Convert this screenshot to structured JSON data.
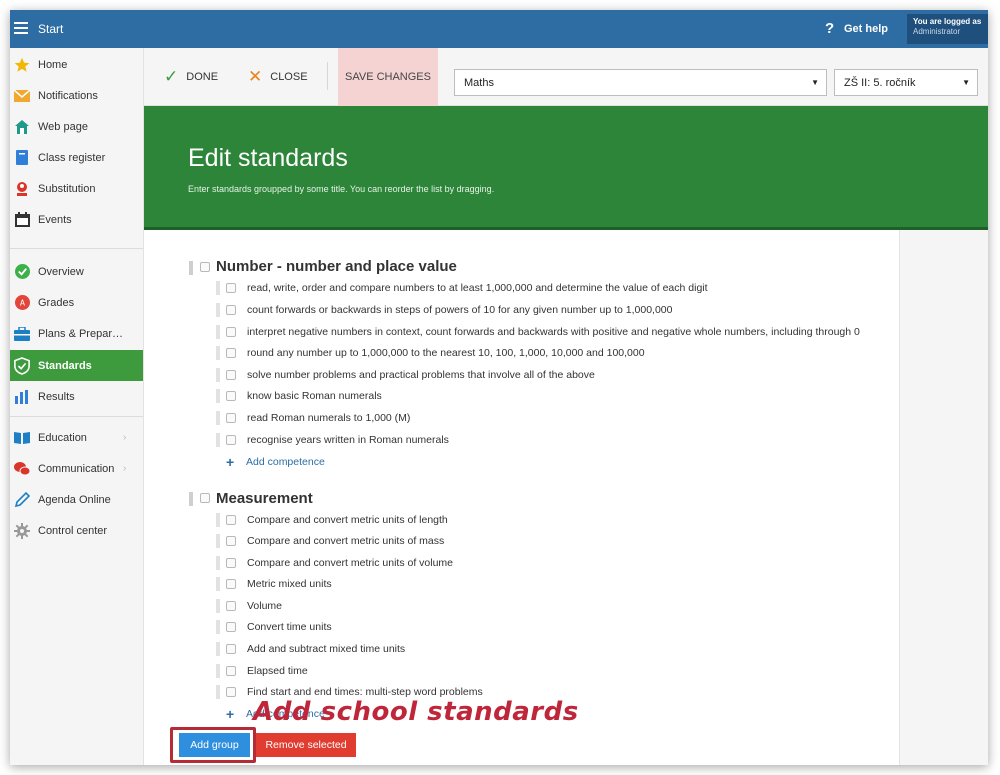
{
  "topbar": {
    "app_title": "Start",
    "help_label": "Get help",
    "user_line1": "You are logged as",
    "user_line2": "Administrator"
  },
  "sidebar": {
    "items": [
      {
        "label": "Home",
        "icon": "star-icon"
      },
      {
        "label": "Notifications",
        "icon": "envelope-icon"
      },
      {
        "label": "Web page",
        "icon": "house-icon"
      },
      {
        "label": "Class register",
        "icon": "book-icon"
      },
      {
        "label": "Substitution",
        "icon": "person-icon"
      },
      {
        "label": "Events",
        "icon": "calendar-icon"
      },
      {
        "label": "Overview",
        "icon": "check-circle-icon"
      },
      {
        "label": "Grades",
        "icon": "grade-icon"
      },
      {
        "label": "Plans & Prepar…",
        "icon": "briefcase-icon"
      },
      {
        "label": "Standards",
        "icon": "shield-check-icon"
      },
      {
        "label": "Results",
        "icon": "bar-chart-icon"
      },
      {
        "label": "Education",
        "icon": "books-icon"
      },
      {
        "label": "Communication",
        "icon": "chat-icon"
      },
      {
        "label": "Agenda Online",
        "icon": "pen-icon"
      },
      {
        "label": "Control center",
        "icon": "gear-icon"
      }
    ]
  },
  "toolbar": {
    "done_label": "DONE",
    "close_label": "CLOSE",
    "save_label": "SAVE CHANGES",
    "subject_value": "Maths",
    "class_value": "ZŠ II: 5. ročník"
  },
  "header": {
    "title": "Edit standards",
    "subtitle": "Enter standards groupped by some title. You can reorder the list by dragging."
  },
  "groups": [
    {
      "title": "Number - number and place value",
      "competences": [
        "read, write, order and compare numbers to at least 1,000,000 and determine the value of each digit",
        "count forwards or backwards in steps of powers of 10 for any given number up to 1,000,000",
        "interpret negative numbers in context, count forwards and backwards with positive and negative whole numbers, including through 0",
        "round any number up to 1,000,000 to the nearest 10, 100, 1,000, 10,000 and 100,000",
        "solve number problems and practical problems that involve all of the above",
        "know basic Roman numerals",
        "read Roman numerals to 1,000 (M)",
        "recognise years written in Roman numerals"
      ],
      "add_label": "Add competence"
    },
    {
      "title": "Measurement",
      "competences": [
        "Compare and convert metric units of length",
        "Compare and convert metric units of  mass",
        "Compare and convert metric units of volume",
        "Metric mixed units",
        "Volume",
        "Convert time units",
        "Add and subtract mixed time units",
        "Elapsed time",
        "Find start and end times: multi-step word problems"
      ],
      "add_label": "Add competence"
    }
  ],
  "actions": {
    "add_group_label": "Add group",
    "remove_selected_label": "Remove selected"
  },
  "annotation": {
    "text": "Add school standards"
  },
  "colors": {
    "topbar": "#2e6da4",
    "header_green": "#2d8539",
    "active_nav": "#3d9b3d",
    "save_bg": "#f6d3d3",
    "add_group": "#2e8fdf",
    "remove": "#e03c2f",
    "annotation": "#c0263a"
  }
}
